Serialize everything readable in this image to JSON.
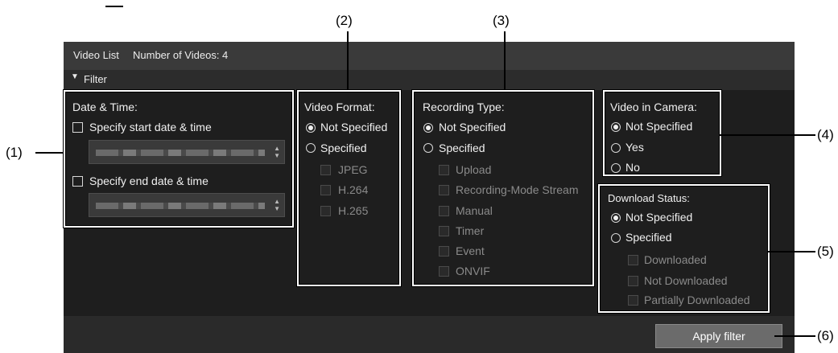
{
  "callouts": {
    "c1": "(1)",
    "c2": "(2)",
    "c3": "(3)",
    "c4": "(4)",
    "c5": "(5)",
    "c6": "(6)"
  },
  "header": {
    "title": "Video List",
    "count_label": "Number of Videos: 4"
  },
  "filter": {
    "toggle_icon": "triangle-down-icon",
    "label": "Filter"
  },
  "datetime": {
    "title": "Date & Time:",
    "start_label": "Specify start date & time",
    "end_label": "Specify end date & time",
    "start_checked": false,
    "end_checked": false
  },
  "video_format": {
    "title": "Video Format:",
    "not_specified": "Not Specified",
    "specified": "Specified",
    "selected": "Not Specified",
    "options": [
      "JPEG",
      "H.264",
      "H.265"
    ]
  },
  "recording_type": {
    "title": "Recording Type:",
    "not_specified": "Not Specified",
    "specified": "Specified",
    "selected": "Not Specified",
    "options": [
      "Upload",
      "Recording-Mode Stream",
      "Manual",
      "Timer",
      "Event",
      "ONVIF"
    ]
  },
  "video_in_camera": {
    "title": "Video in Camera:",
    "options": [
      "Not Specified",
      "Yes",
      "No"
    ],
    "selected": "Not Specified"
  },
  "download_status": {
    "title": "Download Status:",
    "not_specified": "Not Specified",
    "specified": "Specified",
    "selected": "Not Specified",
    "options": [
      "Downloaded",
      "Not Downloaded",
      "Partially Downloaded"
    ]
  },
  "actions": {
    "apply_label": "Apply filter"
  },
  "colors": {
    "panel_bg": "#1e1e1e",
    "titlebar_bg": "#3a3a3a",
    "button_bg": "#6b6b6b",
    "highlight_border": "#ffffff"
  }
}
